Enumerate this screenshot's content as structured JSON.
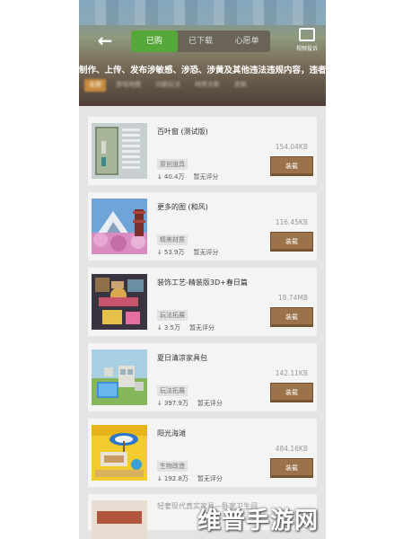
{
  "header": {
    "tabs": [
      {
        "label": "已购",
        "active": true
      },
      {
        "label": "已下载",
        "active": false
      },
      {
        "label": "心愿单",
        "active": false
      }
    ],
    "feedback_label": "视频投诉",
    "warning_text": "制作、上传、发布涉敏感、涉恐、涉黄及其他违法违规内容，违者将",
    "filters": [
      "全部",
      "游戏地图",
      "功能玩法",
      "材质光影",
      "皮肤"
    ]
  },
  "items": [
    {
      "title": "百叶窗 (测试版)",
      "size": "154.04KB",
      "tag": "原创道具",
      "downloads": "40.4万",
      "rating": "暂无评分",
      "button": "装载",
      "thumb": "blinds-thumbnail"
    },
    {
      "title": "更多的图 (和风)",
      "size": "116.45KB",
      "tag": "精美材质",
      "downloads": "53.9万",
      "rating": "暂无评分",
      "button": "装载",
      "thumb": "japanese-scenery-thumbnail"
    },
    {
      "title": "装饰工艺-精装版3D+春日篇",
      "size": "18.74MB",
      "tag": "玩法拓展",
      "downloads": "3.5万",
      "rating": "暂无评分",
      "button": "装载",
      "thumb": "decoration-3d-thumbnail"
    },
    {
      "title": "夏日清凉家具包",
      "size": "142.11KB",
      "tag": "玩法拓展",
      "downloads": "397.9万",
      "rating": "暂无评分",
      "button": "装载",
      "thumb": "summer-furniture-thumbnail"
    },
    {
      "title": "阳光海滩",
      "size": "484.16KB",
      "tag": "生物改造",
      "downloads": "192.8万",
      "rating": "暂无评分",
      "button": "装载",
      "thumb": "sunny-beach-thumbnail"
    }
  ],
  "partial_item": {
    "title": "轻奢现代真实家具—卧室卫生间"
  },
  "watermark": "维普手游网",
  "colors": {
    "tab_active": "#56a83a",
    "button": "#9b7249",
    "filter_active": "#c78b3e"
  }
}
